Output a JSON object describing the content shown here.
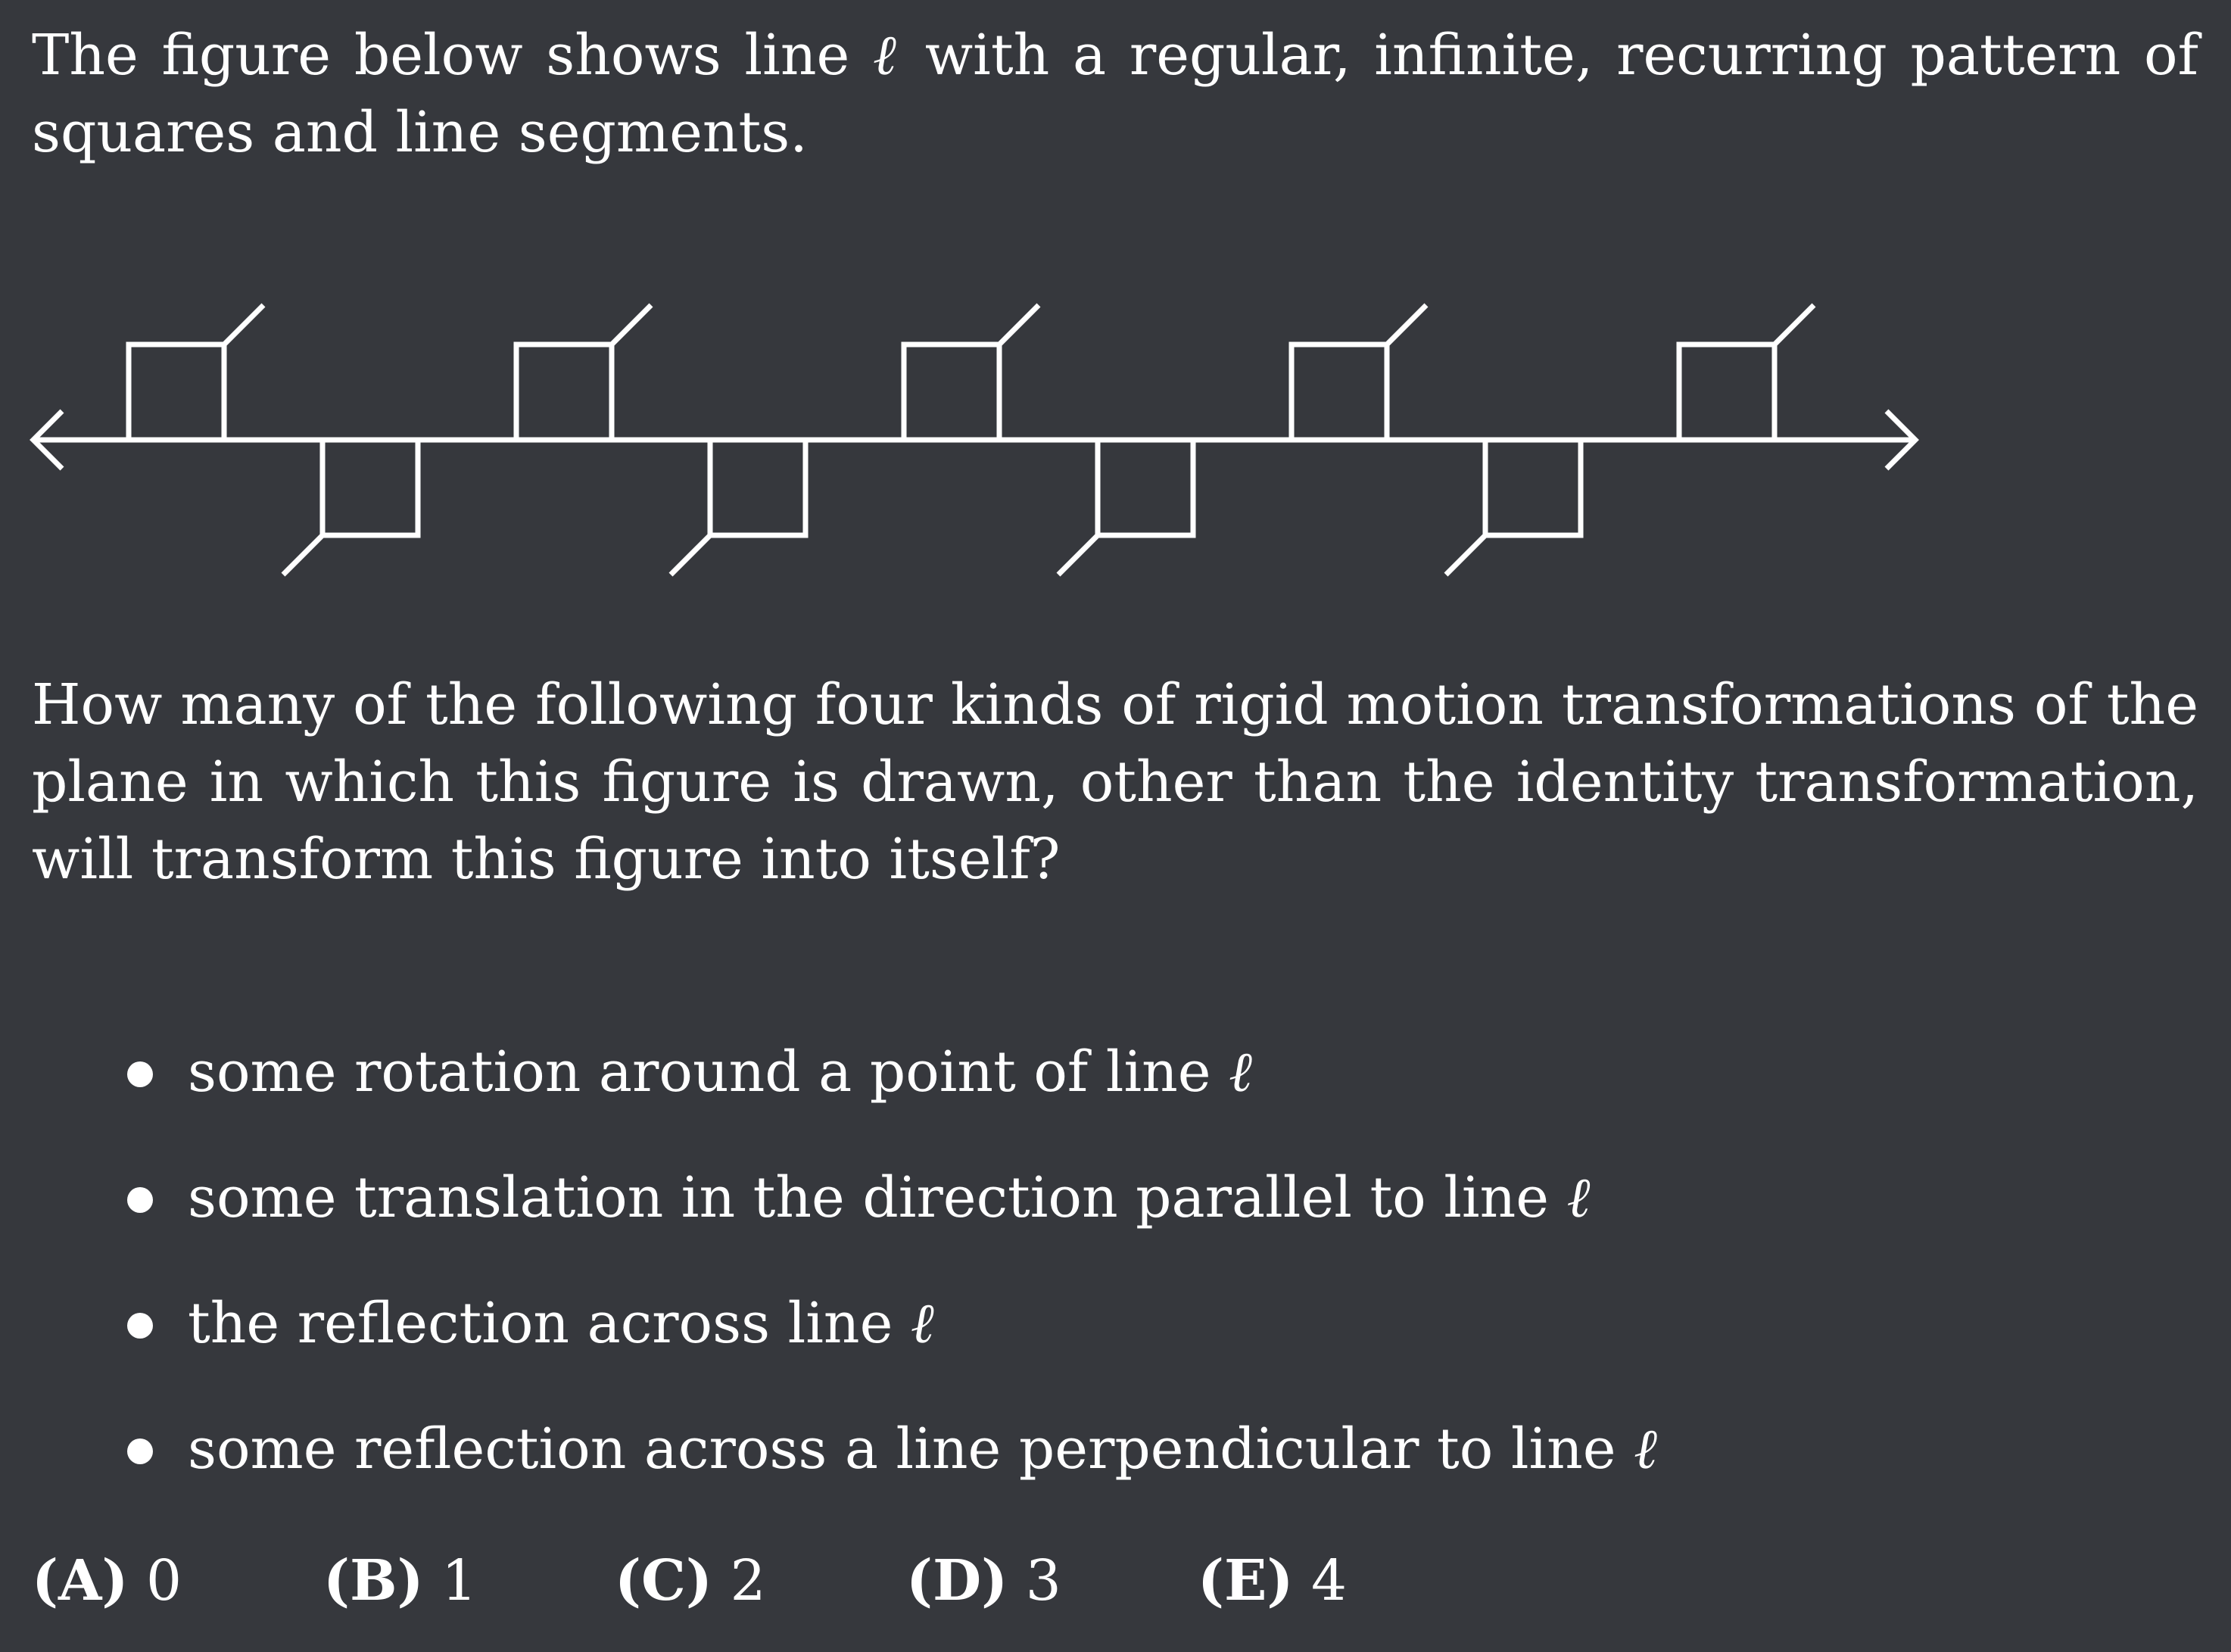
{
  "intro": {
    "before_symbol": "The figure below shows line ",
    "symbol": "ℓ",
    "after_symbol": " with a regular, infinite, recurring pattern of squares and line segments."
  },
  "question": {
    "text": "How many of the following four kinds of rigid motion transformations of the plane in which this figure is drawn, other than the identity transformation, will transform this figure into itself?"
  },
  "bullets": [
    {
      "text": "some rotation around a point of line ",
      "symbol": "ℓ"
    },
    {
      "text": "some translation in the direction parallel to line ",
      "symbol": "ℓ"
    },
    {
      "text": "the reflection across line ",
      "symbol": "ℓ"
    },
    {
      "text": "some reflection across a line perpendicular to line ",
      "symbol": "ℓ"
    }
  ],
  "choices": [
    {
      "letter": "(A)",
      "value": "0"
    },
    {
      "letter": "(B)",
      "value": "1"
    },
    {
      "letter": "(C)",
      "value": "2"
    },
    {
      "letter": "(D)",
      "value": "3"
    },
    {
      "letter": "(E)",
      "value": "4"
    }
  ],
  "figure": {
    "upper_squares": 5,
    "lower_squares": 4,
    "stroke_color": "#ffffff"
  }
}
